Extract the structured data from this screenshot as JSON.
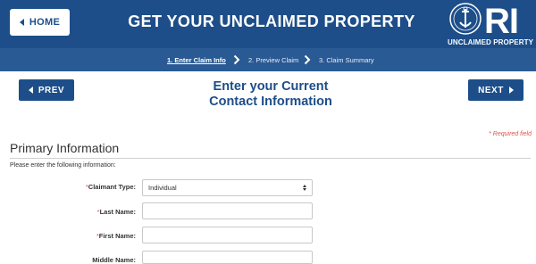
{
  "header": {
    "home_label": "HOME",
    "title": "GET YOUR UNCLAIMED PROPERTY",
    "logo_letters": "RI",
    "logo_caption": "UNCLAIMED PROPERTY"
  },
  "steps": [
    {
      "label": "1. Enter Claim Info",
      "active": true
    },
    {
      "label": "2. Preview Claim",
      "active": false
    },
    {
      "label": "3. Claim Summary",
      "active": false
    }
  ],
  "nav": {
    "prev_label": "PREV",
    "next_label": "NEXT"
  },
  "page": {
    "heading_line1": "Enter your Current",
    "heading_line2": "Contact Information"
  },
  "form": {
    "required_note": "* Required field",
    "section_title": "Primary Information",
    "instructions": "Please enter the following information:",
    "fields": [
      {
        "label": "Claimant Type:",
        "required": "*",
        "value": "Individual"
      },
      {
        "label": "Last Name:",
        "required": "*",
        "value": ""
      },
      {
        "label": "First Name:",
        "required": "*",
        "value": ""
      },
      {
        "label": "Middle Name:",
        "required": "",
        "value": ""
      }
    ]
  },
  "colors": {
    "brand": "#1d4e89",
    "step_bar": "#2a5a94",
    "required": "#e0504a"
  }
}
